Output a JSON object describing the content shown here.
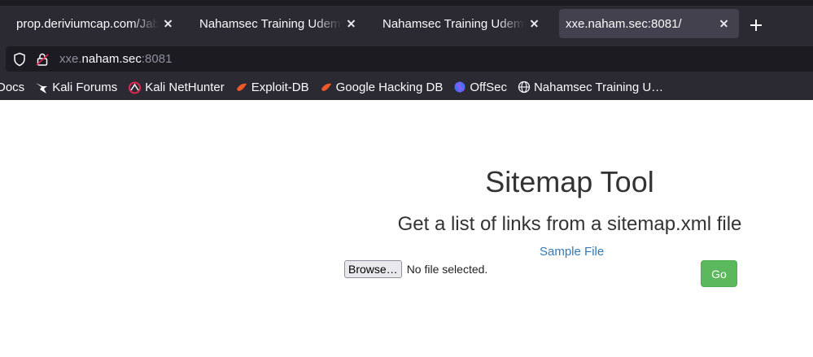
{
  "browser": {
    "tabs": [
      {
        "label": "prop.deriviumcap.com/Jabra",
        "active": false
      },
      {
        "label": "Nahamsec Training Udemy C",
        "active": false
      },
      {
        "label": "Nahamsec Training Udemy C",
        "active": false
      },
      {
        "label": "xxe.naham.sec:8081/",
        "active": true
      }
    ],
    "url": {
      "prefix": "xxe.",
      "host": "naham.sec",
      "suffix": ":8081"
    },
    "bookmarks": [
      {
        "label": "Docs",
        "icon": "kali-icon"
      },
      {
        "label": "Kali Forums",
        "icon": "kali-dragon-icon"
      },
      {
        "label": "Kali NetHunter",
        "icon": "nethunter-icon"
      },
      {
        "label": "Exploit-DB",
        "icon": "exploit-db-icon"
      },
      {
        "label": "Google Hacking DB",
        "icon": "ghdb-icon"
      },
      {
        "label": "OffSec",
        "icon": "offsec-icon"
      },
      {
        "label": "Nahamsec Training U…",
        "icon": "globe-icon"
      }
    ]
  },
  "page": {
    "title": "Sitemap Tool",
    "subtitle": "Get a list of links from a sitemap.xml file",
    "sample_link": "Sample File",
    "browse_label": "Browse…",
    "file_status": "No file selected.",
    "submit_label": "Go"
  },
  "colors": {
    "chrome": "#2b2a33",
    "active_tab": "#42414d",
    "link": "#337ab7",
    "go_button": "#5cb85c"
  }
}
